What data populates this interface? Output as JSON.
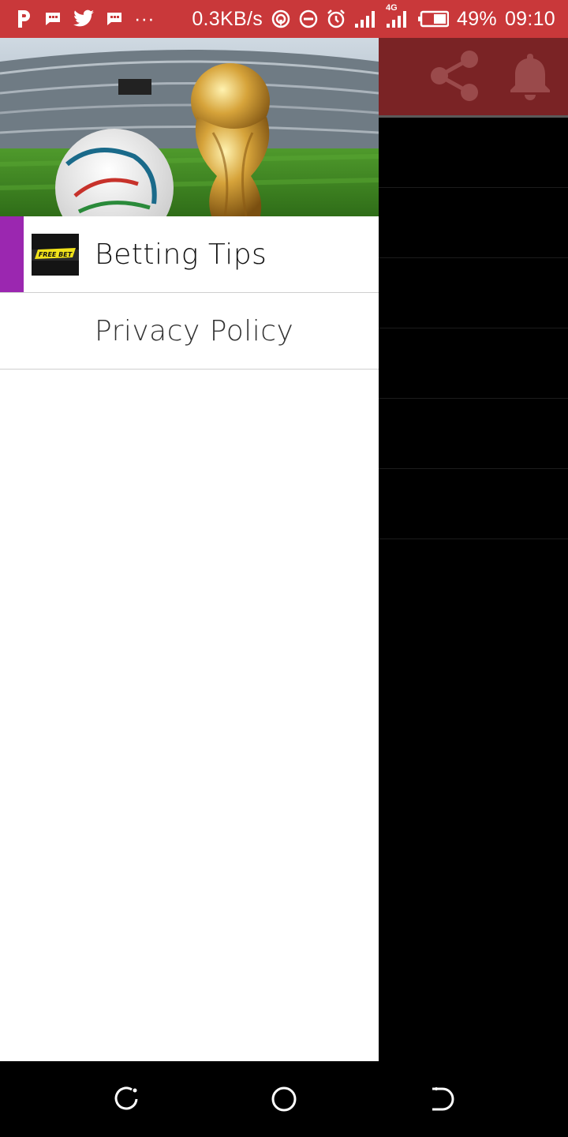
{
  "status_bar": {
    "icons_left": [
      "p-icon",
      "message-icon",
      "twitter-icon",
      "message-icon",
      "more-dots-icon"
    ],
    "more_dots": "···",
    "net_speed": "0.3KB/s",
    "network_type": "4G",
    "battery": "49%",
    "time": "09:10"
  },
  "app_bar": {
    "icons": [
      "share-icon",
      "bell-icon"
    ]
  },
  "drawer": {
    "items": [
      {
        "label": "Betting Tips",
        "thumb_text": "FREE BET",
        "active": true
      },
      {
        "label": "Privacy Policy",
        "active": false
      }
    ]
  },
  "nav_bar": {
    "buttons": [
      "recent-apps-icon",
      "home-icon",
      "back-icon"
    ]
  },
  "colors": {
    "status_bar": "#c9383a",
    "app_bar_dimmed": "#7a2325",
    "active_indicator": "#9b27b0",
    "drawer_bg": "#ffffff"
  }
}
